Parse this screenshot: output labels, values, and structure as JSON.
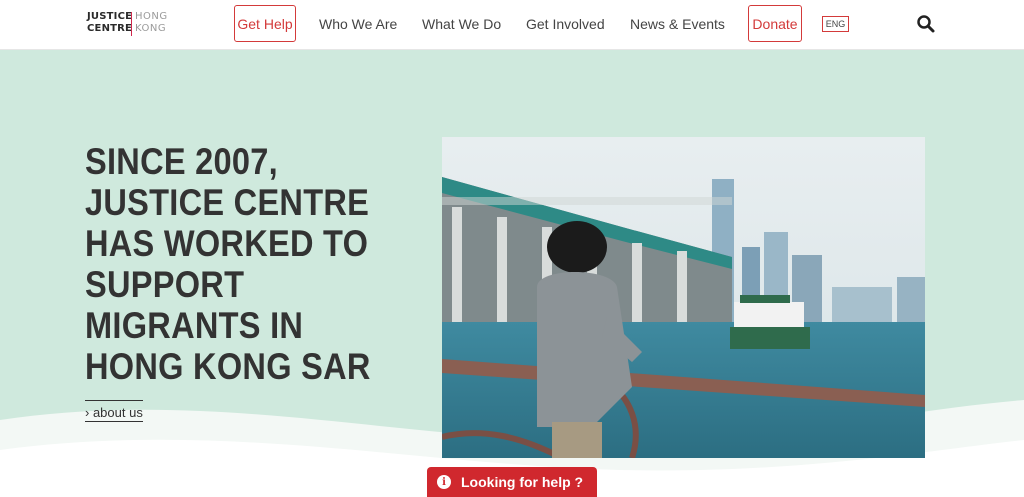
{
  "header": {
    "logo": {
      "left_top": "JUSTICE",
      "left_bottom": "CENTRE",
      "right_top": "HONG",
      "right_bottom": "KONG"
    },
    "get_help_label": "Get Help",
    "nav": [
      {
        "label": "Who We Are"
      },
      {
        "label": "What We Do"
      },
      {
        "label": "Get Involved"
      },
      {
        "label": "News & Events"
      }
    ],
    "donate_label": "Donate",
    "language": "ENG",
    "search_icon": "search-icon"
  },
  "hero": {
    "title": "SINCE 2007, JUSTICE CENTRE HAS WORKED TO SUPPORT MIGRANTS IN HONG KONG SAR",
    "about_link": "› about us"
  },
  "help_bar": {
    "label": "Looking for help ?",
    "icon": "info-icon"
  },
  "colors": {
    "accent": "#d33a3a",
    "hero_bg": "#cfe9dd",
    "help_bar": "#d0282e"
  }
}
